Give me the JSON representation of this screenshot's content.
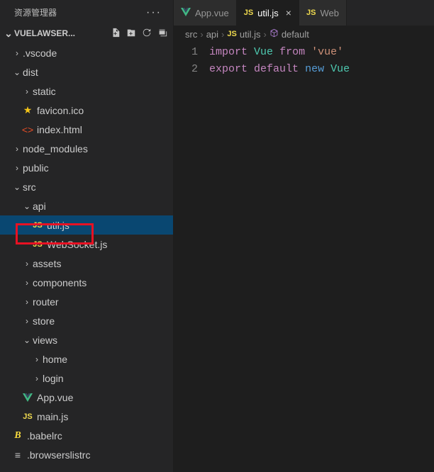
{
  "sidebar": {
    "title": "资源管理器",
    "project_name": "VUELAWSER...",
    "actions": {
      "new_file": "",
      "new_folder": "",
      "refresh": "",
      "collapse_all": ""
    }
  },
  "tree": {
    "vscode": ".vscode",
    "dist": "dist",
    "static": "static",
    "favicon": "favicon.ico",
    "index_html": "index.html",
    "node_modules": "node_modules",
    "public": "public",
    "src": "src",
    "api": "api",
    "util_js": "util.js",
    "websocket_js": "WebSocket.js",
    "assets": "assets",
    "components": "components",
    "router": "router",
    "store": "store",
    "views": "views",
    "home": "home",
    "login": "login",
    "app_vue": "App.vue",
    "main_js": "main.js",
    "babelrc": ".babelrc",
    "browserslistrc": ".browserslistrc"
  },
  "tabs": {
    "app_vue": "App.vue",
    "util_js": "util.js",
    "web": "Web"
  },
  "breadcrumbs": {
    "src": "src",
    "api": "api",
    "util_js": "util.js",
    "default": "default"
  },
  "code": {
    "line1_import": "import",
    "line1_vue": "Vue",
    "line1_from": "from",
    "line1_str": "'vue'",
    "line2_export": "export",
    "line2_default": "default",
    "line2_new": "new",
    "line2_vue": "Vue",
    "ln1": "1",
    "ln2": "2"
  }
}
